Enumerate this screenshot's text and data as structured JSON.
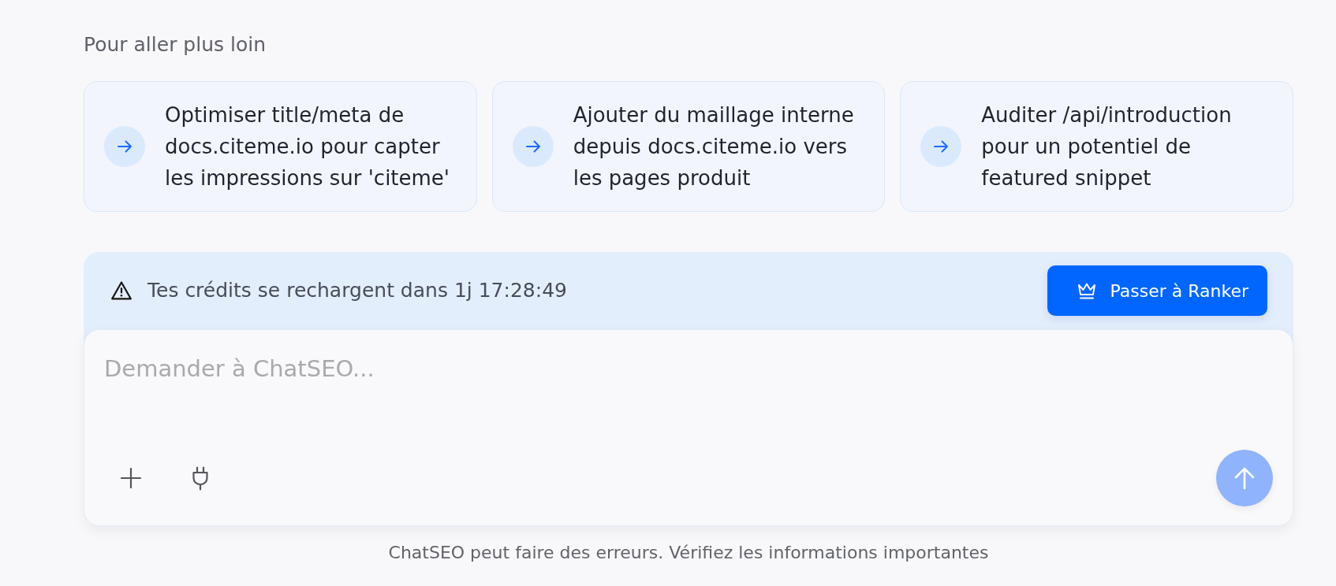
{
  "section": {
    "title": "Pour aller plus loin",
    "suggestions": [
      {
        "text": "Optimiser title/meta de docs.citeme.io pour capter les impressions sur 'citeme'"
      },
      {
        "text": "Ajouter du maillage interne depuis docs.citeme.io vers les pages produit"
      },
      {
        "text": "Auditer /api/introduction pour un potentiel de featured snippet"
      }
    ]
  },
  "credits_banner": {
    "message": "Tes crédits se rechargent dans 1j 17:28:49",
    "upgrade_button": {
      "label": "Passer à Ranker"
    }
  },
  "composer": {
    "placeholder": "Demander à ChatSEO...",
    "send_button": {
      "disabled": true
    }
  },
  "disclaimer": "ChatSEO peut faire des erreurs. Vérifiez les informations importantes"
}
